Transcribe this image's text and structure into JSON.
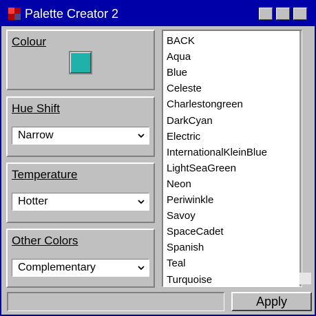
{
  "window": {
    "title": "Palette Creator 2",
    "icon": "palette-app-icon",
    "colors": {
      "titlebar": "#0000a8",
      "face": "#c0c0c0"
    }
  },
  "colour_group": {
    "label": "Colour",
    "swatch_color": "#20b2aa"
  },
  "hue_shift": {
    "label": "Hue Shift",
    "value": "Narrow",
    "icon": "chevron-down-icon"
  },
  "temperature": {
    "label": "Temperature",
    "value": "Hotter",
    "icon": "chevron-down-icon"
  },
  "other_colors": {
    "label": "Other Colors",
    "value": "Complementary",
    "icon": "chevron-down-icon"
  },
  "color_list": [
    "BACK",
    "Aqua",
    "Blue",
    "Celeste",
    "Charlestongreen",
    "DarkCyan",
    "Electric",
    "InternationalKleinBlue",
    "LightSeaGreen",
    "Neon",
    "Periwinkle",
    "Savoy",
    "SpaceCadet",
    "Spanish",
    "Teal",
    "Turquoise"
  ],
  "status_text": "",
  "apply_label": "Apply"
}
